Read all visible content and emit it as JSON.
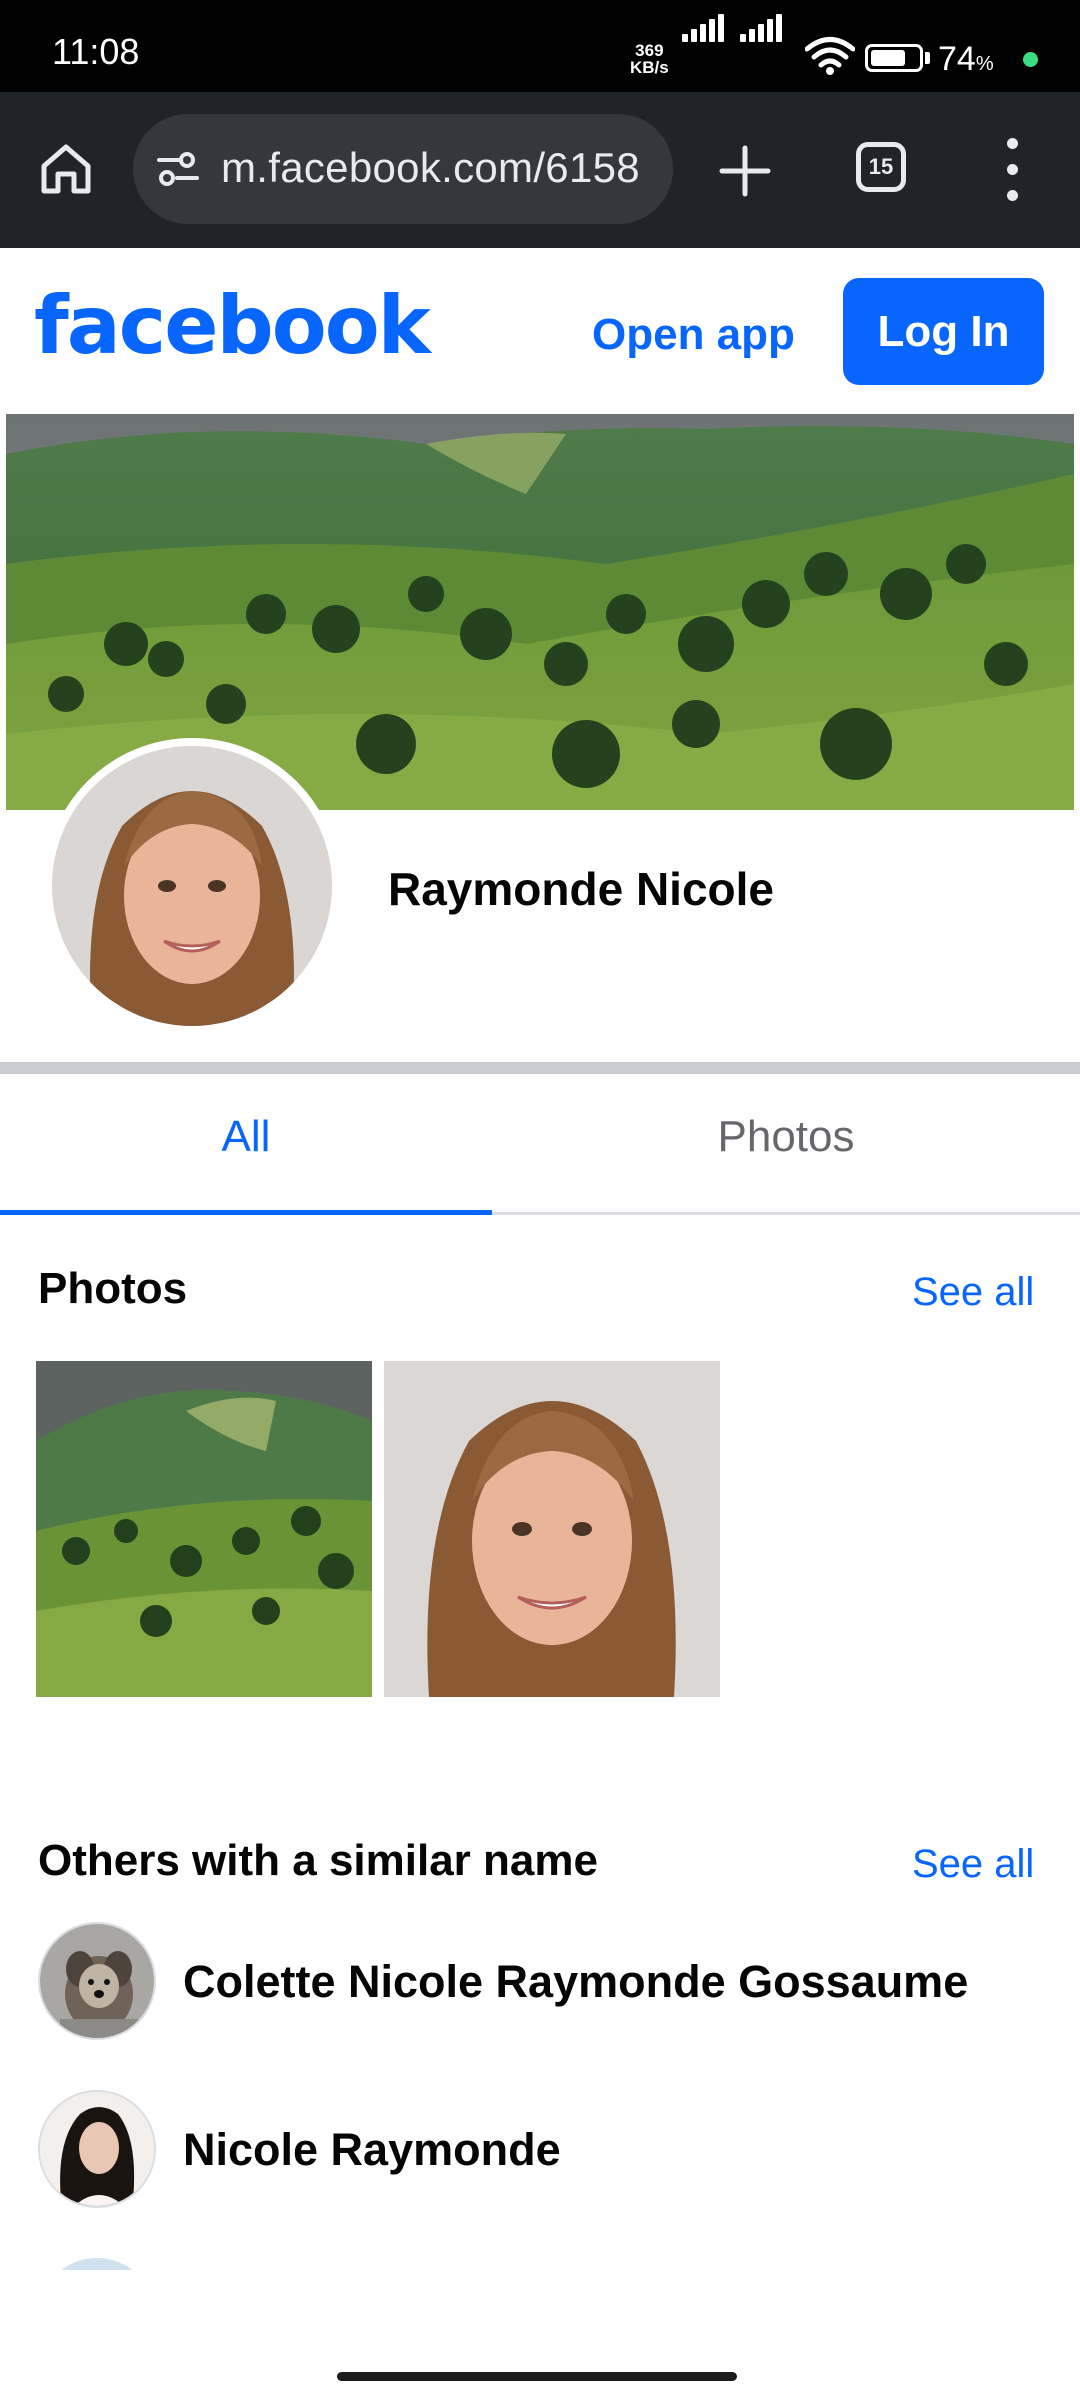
{
  "status_bar": {
    "time": "11:08",
    "net_speed_value": "369",
    "net_speed_unit": "KB/s",
    "battery_percent": "74",
    "battery_unit": "%",
    "battery_level": 0.74
  },
  "browser": {
    "url": "m.facebook.com/6158",
    "tab_count": "15",
    "icons": [
      "home-icon",
      "site-settings-icon",
      "plus-icon",
      "tabs-icon",
      "more-vert-icon"
    ]
  },
  "header": {
    "logo_text": "facebook",
    "open_app_label": "Open app",
    "login_label": "Log In",
    "brand_color": "#0866ff"
  },
  "profile": {
    "name": "Raymonde Nicole"
  },
  "tabs": [
    {
      "label": "All",
      "active": true
    },
    {
      "label": "Photos",
      "active": false
    }
  ],
  "photos_section": {
    "title": "Photos",
    "see_all_label": "See all"
  },
  "similar_section": {
    "title": "Others with a similar name",
    "see_all_label": "See all",
    "people": [
      {
        "name": "Colette Nicole Raymonde Gossaume"
      },
      {
        "name": "Nicole Raymonde"
      }
    ]
  }
}
